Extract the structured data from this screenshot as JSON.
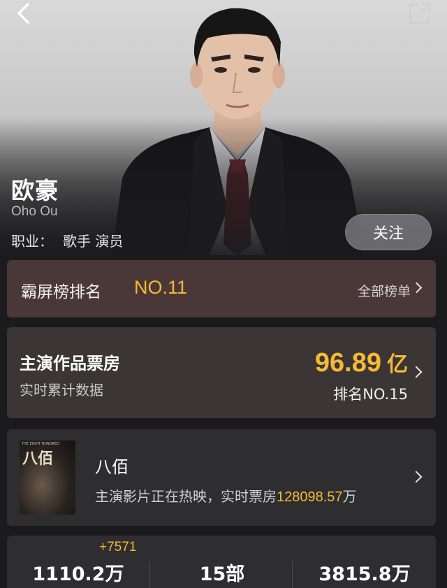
{
  "header": {
    "back_icon": "chevron-left-icon",
    "share_icon": "share-external-icon"
  },
  "profile": {
    "name": "欧豪",
    "english_name": "Oho Ou",
    "occupation_label": "职业：",
    "occupation_value": "歌手 演员",
    "follow_label": "关注"
  },
  "ranking": {
    "label": "霸屏榜排名",
    "value": "NO.11",
    "all_link": "全部榜单"
  },
  "box_office": {
    "title": "主演作品票房",
    "subtitle": "实时累计数据",
    "amount": "96.89",
    "unit": "亿",
    "rank": "排名NO.15"
  },
  "film": {
    "poster_title": "八佰",
    "poster_caption": "THE EIGHT HUNDRED",
    "title": "八佰",
    "desc_prefix": "主演影片正在热映，实时票房",
    "desc_number": "128098.57",
    "desc_suffix": "万"
  },
  "stats": {
    "delta": "+7571",
    "items": [
      {
        "value": "1110.2万"
      },
      {
        "value": "15部"
      },
      {
        "value": "3815.8万"
      }
    ]
  },
  "colors": {
    "accent": "#f6b934",
    "rank_card_bg": "#4a3738",
    "box_card_bg": "#3b3635",
    "card_bg": "#2e2e30",
    "page_bg": "#1b1b1d"
  }
}
